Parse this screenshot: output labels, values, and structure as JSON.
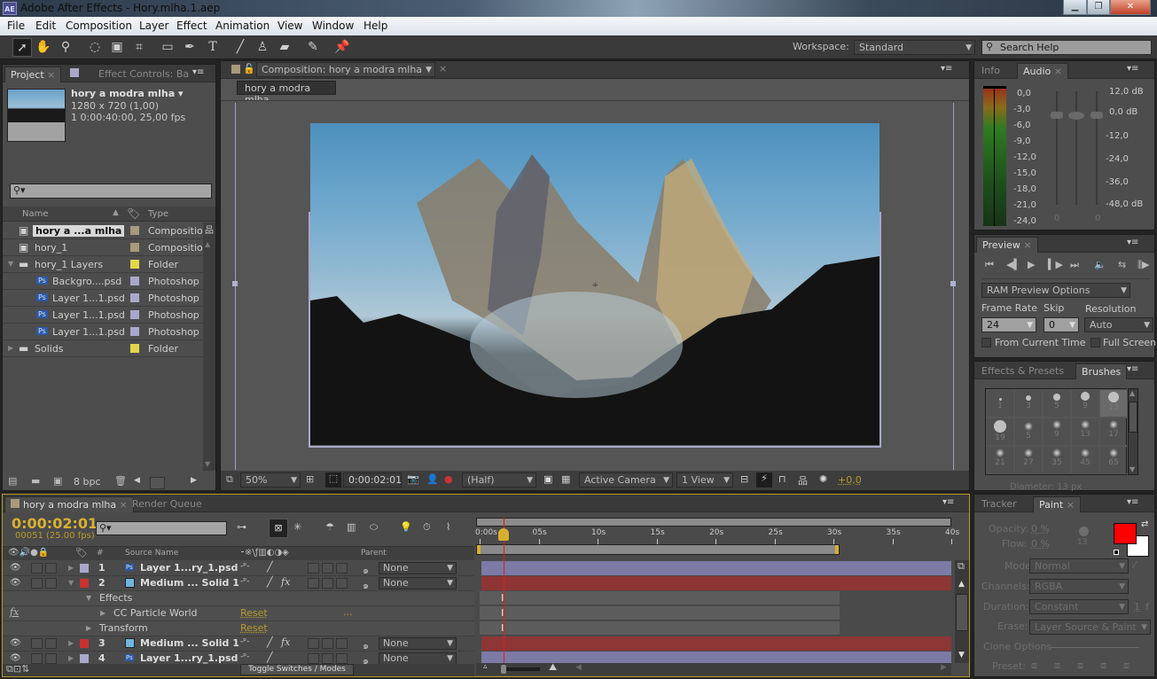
{
  "window": {
    "title": "Adobe After Effects - Hory.mlha.1.aep",
    "app_icon": "AE",
    "controls": [
      "minimize",
      "restore",
      "close"
    ]
  },
  "menu": [
    "File",
    "Edit",
    "Composition",
    "Layer",
    "Effect",
    "Animation",
    "View",
    "Window",
    "Help"
  ],
  "toolbar": {
    "tools": [
      "selection-tool",
      "hand-tool",
      "zoom-tool",
      "rotation-tool",
      "camera-tool",
      "pan-behind-tool",
      "rectangle-tool",
      "pen-tool",
      "type-tool",
      "brush-tool",
      "clone-stamp-tool",
      "eraser-tool",
      "roto-brush-tool",
      "puppet-pin-tool"
    ],
    "workspace_label": "Workspace:",
    "workspace_value": "Standard",
    "search_placeholder": "Search Help"
  },
  "project": {
    "tabs": [
      "Project",
      "Effect Controls: Ba"
    ],
    "selected_name": "hory a modra mlha ▾",
    "selected_dims": "1280 x 720 (1,00)",
    "selected_duration": "1 0:00:40:00, 25,00 fps",
    "col_name": "Name",
    "col_type": "Type",
    "items": [
      {
        "name": "hory a ...a mlha",
        "type": "Compositio",
        "icon": "composition-icon",
        "color": "#a89a7a",
        "indent": 0,
        "selected": true
      },
      {
        "name": "hory_1",
        "type": "Compositio",
        "icon": "composition-icon",
        "color": "#a89a7a",
        "indent": 0
      },
      {
        "name": "hory_1 Layers",
        "type": "Folder",
        "icon": "folder-icon",
        "color": "#e4d64a",
        "indent": 0,
        "expanded": true
      },
      {
        "name": "Backgro....psd",
        "type": "Photoshop",
        "icon": "psd-icon",
        "color": "#a9a8cc",
        "indent": 1
      },
      {
        "name": "Layer 1...1.psd",
        "type": "Photoshop",
        "icon": "psd-icon",
        "color": "#a9a8cc",
        "indent": 1
      },
      {
        "name": "Layer 1...1.psd",
        "type": "Photoshop",
        "icon": "psd-icon",
        "color": "#a9a8cc",
        "indent": 1
      },
      {
        "name": "Layer 1...1.psd",
        "type": "Photoshop",
        "icon": "psd-icon",
        "color": "#a9a8cc",
        "indent": 1
      },
      {
        "name": "Solids",
        "type": "Folder",
        "icon": "folder-icon",
        "color": "#e4d64a",
        "indent": 0,
        "expanded": false
      }
    ],
    "bpc": "8 bpc"
  },
  "composition": {
    "tab_label": "Composition: hory a modra mlha",
    "breadcrumb": "hory a modra mlha",
    "zoom": "50%",
    "timecode": "0:00:02:01",
    "resolution": "(Half)",
    "camera": "Active Camera",
    "views": "1 View",
    "exposure": "+0,0"
  },
  "audio": {
    "tabs": [
      "Info",
      "Audio"
    ],
    "left_scale": [
      "0,0",
      "-3,0",
      "-6,0",
      "-9,0",
      "-12,0",
      "-15,0",
      "-18,0",
      "-21,0",
      "-24,0"
    ],
    "right_scale": [
      "12,0 dB",
      "0,0 dB",
      "-12,0",
      "-24,0",
      "-36,0",
      "-48,0 dB"
    ],
    "slider_values": [
      "0",
      "0"
    ]
  },
  "preview": {
    "tab": "Preview",
    "ram_options": "RAM Preview Options",
    "frame_rate_label": "Frame Rate",
    "frame_rate": "24",
    "skip_label": "Skip",
    "skip": "0",
    "resolution_label": "Resolution",
    "resolution": "Auto",
    "from_current": "From Current Time",
    "full_screen": "Full Screen"
  },
  "brushes": {
    "tabs": [
      "Effects & Presets",
      "Brushes"
    ],
    "sizes": [
      "1",
      "3",
      "5",
      "9",
      "13",
      "19",
      "5",
      "9",
      "13",
      "17",
      "21",
      "27",
      "35",
      "45",
      "65"
    ],
    "selected": "13",
    "diameter": "Diameter: 13 px"
  },
  "paint": {
    "tabs": [
      "Tracker",
      "Paint"
    ],
    "opacity_label": "Opacity:",
    "opacity": "0 %",
    "flow_label": "Flow:",
    "flow": "0 %",
    "brush_size": "13",
    "fg_color": "#ff0000",
    "bg_color": "#ffffff",
    "mode_label": "Mode:",
    "mode": "Normal",
    "channels_label": "Channels:",
    "channels": "RGBA",
    "duration_label": "Duration:",
    "duration": "Constant",
    "duration_frames": "1",
    "duration_unit": "f",
    "erase_label": "Erase:",
    "erase": "Layer Source & Paint",
    "clone_options": "Clone Options",
    "preset_label": "Preset:"
  },
  "timeline": {
    "tabs": [
      "hory a modra mlha",
      "Render Queue"
    ],
    "timecode": "0:00:02:01",
    "frame_info": "00051 (25.00 fps)",
    "col_hash": "#",
    "col_source": "Source Name",
    "col_parent": "Parent",
    "ruler": [
      "0:00s",
      "05s",
      "10s",
      "15s",
      "20s",
      "25s",
      "30s",
      "35s",
      "40s"
    ],
    "duration_s": 40,
    "current_time_s": 2.04,
    "work_area_end_s": 30.5,
    "layers": [
      {
        "num": "1",
        "name": "Layer 1...ry_1.psd",
        "label_color": "#a9a8cc",
        "type": "psd",
        "fx": false,
        "parent": "None",
        "bar_color": "#7b7ba6"
      },
      {
        "num": "2",
        "name": "Medium ... Solid 1",
        "label_color": "#c83232",
        "type": "solid",
        "fx": true,
        "parent": "None",
        "bar_color": "#8e3535",
        "expanded": true
      },
      {
        "num": "3",
        "name": "Medium ... Solid 1",
        "label_color": "#c83232",
        "type": "solid",
        "fx": true,
        "parent": "None",
        "bar_color": "#8e3535"
      },
      {
        "num": "4",
        "name": "Layer 1...ry_1.psd",
        "label_color": "#a9a8cc",
        "type": "psd",
        "fx": false,
        "parent": "None",
        "bar_color": "#7b7ba6"
      }
    ],
    "effects_label": "Effects",
    "effect_name": "CC Particle World",
    "transform_label": "Transform",
    "reset_label": "Reset",
    "toggle_label": "Toggle Switches / Modes"
  }
}
